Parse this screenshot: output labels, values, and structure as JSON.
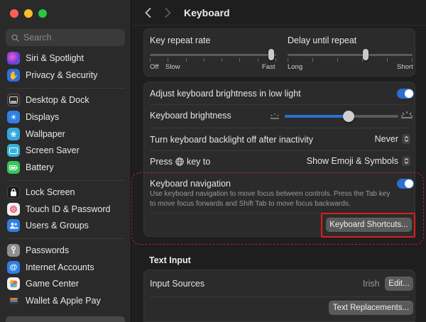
{
  "window": {
    "title": "Keyboard"
  },
  "search": {
    "placeholder": "Search"
  },
  "sidebar": {
    "items": [
      {
        "label": "Siri & Spotlight",
        "icon": "siri-icon",
        "color": "#7a3fd8"
      },
      {
        "label": "Privacy & Security",
        "icon": "hand-icon",
        "color": "#2f6fdf"
      },
      {
        "label": "Desktop & Dock",
        "icon": "dock-icon",
        "color": "#2c2c2c"
      },
      {
        "label": "Displays",
        "icon": "sun-icon",
        "color": "#2f7fe6"
      },
      {
        "label": "Wallpaper",
        "icon": "flower-icon",
        "color": "#33a7e0"
      },
      {
        "label": "Screen Saver",
        "icon": "screensaver-icon",
        "color": "#36b3d9"
      },
      {
        "label": "Battery",
        "icon": "battery-icon",
        "color": "#34c759"
      },
      {
        "label": "Lock Screen",
        "icon": "lock-icon",
        "color": "#1c1c1c"
      },
      {
        "label": "Touch ID & Password",
        "icon": "fingerprint-icon",
        "color": "#f2f2f2"
      },
      {
        "label": "Users & Groups",
        "icon": "users-icon",
        "color": "#2f7fe6"
      },
      {
        "label": "Passwords",
        "icon": "key-icon",
        "color": "#8e8e93"
      },
      {
        "label": "Internet Accounts",
        "icon": "at-icon",
        "color": "#2f7fe6"
      },
      {
        "label": "Game Center",
        "icon": "gamecenter-icon",
        "color": "#f2f2f2"
      },
      {
        "label": "Wallet & Apple Pay",
        "icon": "wallet-icon",
        "color": "#2c2c2c"
      }
    ]
  },
  "keyboard": {
    "key_repeat": {
      "label": "Key repeat rate",
      "min_label": "Off",
      "slow_label": "Slow",
      "max_label": "Fast",
      "value": 0.98
    },
    "delay_repeat": {
      "label": "Delay until repeat",
      "min_label": "Long",
      "max_label": "Short",
      "value": 0.63
    },
    "adjust_brightness": {
      "label": "Adjust keyboard brightness in low light",
      "on": true
    },
    "brightness": {
      "label": "Keyboard brightness",
      "value": 0.56
    },
    "backlight_off": {
      "label": "Turn keyboard backlight off after inactivity",
      "value": "Never"
    },
    "press_globe": {
      "label_before": "Press",
      "label_after": "key to",
      "value": "Show Emoji & Symbols"
    },
    "keyboard_navigation": {
      "label": "Keyboard navigation",
      "description_line1": "Use keyboard navigation to move focus between controls. Press the Tab key",
      "description_line2": "to move focus forwards and Shift Tab to move focus backwards.",
      "on": true,
      "shortcuts_button": "Keyboard Shortcuts..."
    }
  },
  "text_input": {
    "title": "Text Input",
    "input_sources_label": "Input Sources",
    "input_sources_value": "Irish",
    "edit_button": "Edit...",
    "replacements_button": "Text Replacements..."
  },
  "colors": {
    "accent": "#2b6fd1",
    "highlight_red": "#e11b1b"
  }
}
